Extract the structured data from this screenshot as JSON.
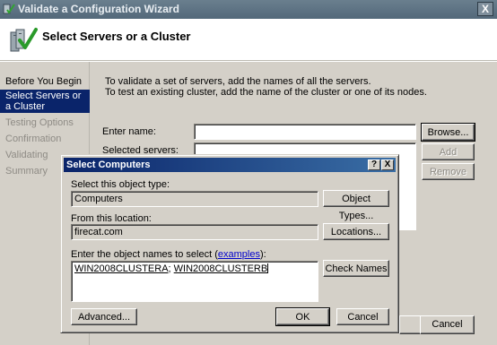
{
  "window": {
    "title": "Validate a Configuration Wizard",
    "close_glyph": "X",
    "heading": "Select Servers or a Cluster",
    "icons": {
      "app": "cluster-validate-icon",
      "wizard": "servers-checkmark-icon"
    }
  },
  "steps": [
    {
      "label": "Before You Begin",
      "state": "done"
    },
    {
      "label": "Select Servers or a Cluster",
      "state": "current"
    },
    {
      "label": "Testing Options",
      "state": "pending"
    },
    {
      "label": "Confirmation",
      "state": "pending"
    },
    {
      "label": "Validating",
      "state": "pending"
    },
    {
      "label": "Summary",
      "state": "pending"
    }
  ],
  "main": {
    "intro_line1": "To validate a set of servers, add the names of all the servers.",
    "intro_line2": "To test an existing cluster, add the name of the cluster or one of its nodes.",
    "enter_name_label": "Enter name:",
    "enter_name_value": "",
    "selected_servers_label": "Selected servers:",
    "browse_label": "Browse...",
    "add_label": "Add",
    "remove_label": "Remove",
    "cancel_label": "Cancel"
  },
  "dialog": {
    "title": "Select Computers",
    "help_glyph": "?",
    "close_glyph": "X",
    "object_type_label": "Select this object type:",
    "object_type_value": "Computers",
    "object_types_button": "Object Types...",
    "location_label": "From this location:",
    "location_value": "firecat.com",
    "locations_button": "Locations...",
    "names_label_prefix": "Enter the object names to select (",
    "names_label_link": "examples",
    "names_label_suffix": "):",
    "names_value_1": "WIN2008CLUSTERA",
    "names_separator": "; ",
    "names_value_2": "WIN2008CLUSTERB",
    "check_names_button": "Check Names",
    "advanced_button": "Advanced...",
    "ok_button": "OK",
    "cancel_button": "Cancel"
  },
  "colors": {
    "selection": "#0a246a",
    "face": "#d4d0c8",
    "disabled_text": "#8e8b85",
    "link": "#0000cc"
  }
}
